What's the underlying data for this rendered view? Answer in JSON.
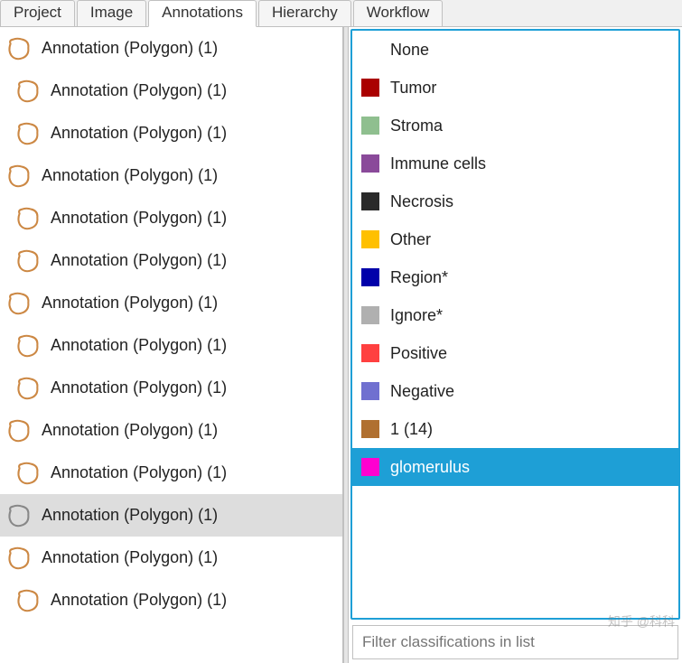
{
  "tabs": [
    {
      "label": "Project",
      "active": false
    },
    {
      "label": "Image",
      "active": false
    },
    {
      "label": "Annotations",
      "active": true
    },
    {
      "label": "Hierarchy",
      "active": false
    },
    {
      "label": "Workflow",
      "active": false
    }
  ],
  "annotations": [
    {
      "label": "Annotation (Polygon) (1)",
      "indent": false,
      "selected": false
    },
    {
      "label": "Annotation (Polygon) (1)",
      "indent": true,
      "selected": false
    },
    {
      "label": "Annotation (Polygon) (1)",
      "indent": true,
      "selected": false
    },
    {
      "label": "Annotation (Polygon) (1)",
      "indent": false,
      "selected": false
    },
    {
      "label": "Annotation (Polygon) (1)",
      "indent": true,
      "selected": false
    },
    {
      "label": "Annotation (Polygon) (1)",
      "indent": true,
      "selected": false
    },
    {
      "label": "Annotation (Polygon) (1)",
      "indent": false,
      "selected": false
    },
    {
      "label": "Annotation (Polygon) (1)",
      "indent": true,
      "selected": false
    },
    {
      "label": "Annotation (Polygon) (1)",
      "indent": true,
      "selected": false
    },
    {
      "label": "Annotation (Polygon) (1)",
      "indent": false,
      "selected": false
    },
    {
      "label": "Annotation (Polygon) (1)",
      "indent": true,
      "selected": false
    },
    {
      "label": "Annotation (Polygon) (1)",
      "indent": false,
      "selected": true
    },
    {
      "label": "Annotation (Polygon) (1)",
      "indent": false,
      "selected": false
    },
    {
      "label": "Annotation (Polygon) (1)",
      "indent": true,
      "selected": false
    }
  ],
  "classes": [
    {
      "label": "None",
      "color": "",
      "selected": false
    },
    {
      "label": "Tumor",
      "color": "#aa0000",
      "selected": false
    },
    {
      "label": "Stroma",
      "color": "#8fbf8f",
      "selected": false
    },
    {
      "label": "Immune cells",
      "color": "#8a4a9a",
      "selected": false
    },
    {
      "label": "Necrosis",
      "color": "#2a2a2a",
      "selected": false
    },
    {
      "label": "Other",
      "color": "#ffc000",
      "selected": false
    },
    {
      "label": "Region*",
      "color": "#0000aa",
      "selected": false
    },
    {
      "label": "Ignore*",
      "color": "#b0b0b0",
      "selected": false
    },
    {
      "label": "Positive",
      "color": "#ff4040",
      "selected": false
    },
    {
      "label": "Negative",
      "color": "#7070d0",
      "selected": false
    },
    {
      "label": "1 (14)",
      "color": "#b07030",
      "selected": false
    },
    {
      "label": "glomerulus",
      "color": "#ff00d0",
      "selected": true
    }
  ],
  "filter": {
    "placeholder": "Filter classifications in list"
  },
  "watermark": "知乎 @科科"
}
